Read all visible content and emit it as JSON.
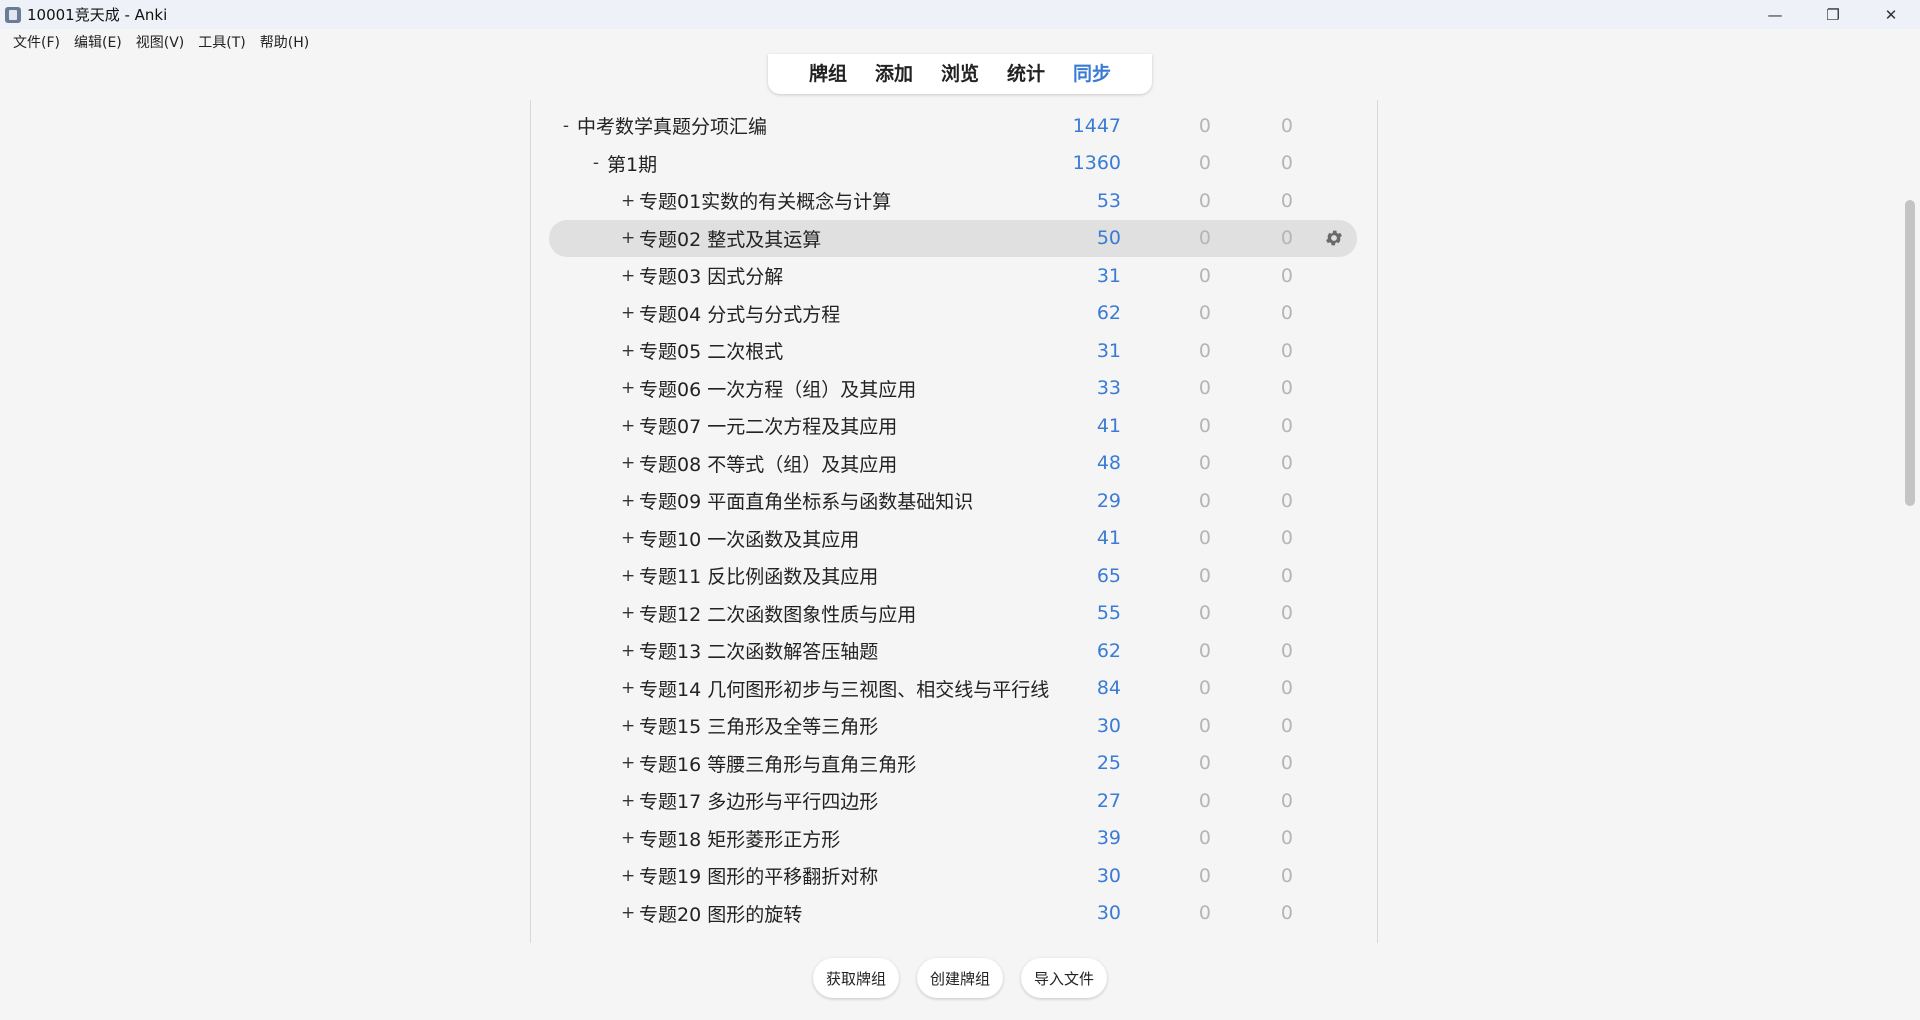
{
  "window": {
    "title": "10001竞天成 - Anki",
    "minimize_glyph": "—",
    "restore_glyph": "❐",
    "close_glyph": "✕"
  },
  "menu": [
    "文件(F)",
    "编辑(E)",
    "视图(V)",
    "工具(T)",
    "帮助(H)"
  ],
  "toolbar": {
    "items": [
      "牌组",
      "添加",
      "浏览",
      "统计",
      "同步"
    ],
    "active_index": 4,
    "active_color": "#3a7bd5"
  },
  "decks": [
    {
      "toggle": "-",
      "name": "中考数学真题分项汇编",
      "level": 0,
      "new": "1447",
      "learn": "0",
      "review": "0"
    },
    {
      "toggle": "-",
      "name": "第1期",
      "level": 1,
      "new": "1360",
      "learn": "0",
      "review": "0"
    },
    {
      "toggle": "+",
      "name": "专题01实数的有关概念与计算",
      "level": 2,
      "new": "53",
      "learn": "0",
      "review": "0"
    },
    {
      "toggle": "+",
      "name": "专题02 整式及其运算",
      "level": 2,
      "new": "50",
      "learn": "0",
      "review": "0",
      "current": true
    },
    {
      "toggle": "+",
      "name": "专题03 因式分解",
      "level": 2,
      "new": "31",
      "learn": "0",
      "review": "0"
    },
    {
      "toggle": "+",
      "name": "专题04 分式与分式方程",
      "level": 2,
      "new": "62",
      "learn": "0",
      "review": "0"
    },
    {
      "toggle": "+",
      "name": "专题05 二次根式",
      "level": 2,
      "new": "31",
      "learn": "0",
      "review": "0"
    },
    {
      "toggle": "+",
      "name": "专题06 一次方程（组）及其应用",
      "level": 2,
      "new": "33",
      "learn": "0",
      "review": "0"
    },
    {
      "toggle": "+",
      "name": "专题07 一元二次方程及其应用",
      "level": 2,
      "new": "41",
      "learn": "0",
      "review": "0"
    },
    {
      "toggle": "+",
      "name": "专题08 不等式（组）及其应用",
      "level": 2,
      "new": "48",
      "learn": "0",
      "review": "0"
    },
    {
      "toggle": "+",
      "name": "专题09 平面直角坐标系与函数基础知识",
      "level": 2,
      "new": "29",
      "learn": "0",
      "review": "0"
    },
    {
      "toggle": "+",
      "name": "专题10 一次函数及其应用",
      "level": 2,
      "new": "41",
      "learn": "0",
      "review": "0"
    },
    {
      "toggle": "+",
      "name": "专题11 反比例函数及其应用",
      "level": 2,
      "new": "65",
      "learn": "0",
      "review": "0"
    },
    {
      "toggle": "+",
      "name": "专题12 二次函数图象性质与应用",
      "level": 2,
      "new": "55",
      "learn": "0",
      "review": "0"
    },
    {
      "toggle": "+",
      "name": "专题13 二次函数解答压轴题",
      "level": 2,
      "new": "62",
      "learn": "0",
      "review": "0"
    },
    {
      "toggle": "+",
      "name": "专题14 几何图形初步与三视图、相交线与平行线",
      "level": 2,
      "new": "84",
      "learn": "0",
      "review": "0"
    },
    {
      "toggle": "+",
      "name": "专题15 三角形及全等三角形",
      "level": 2,
      "new": "30",
      "learn": "0",
      "review": "0"
    },
    {
      "toggle": "+",
      "name": "专题16 等腰三角形与直角三角形",
      "level": 2,
      "new": "25",
      "learn": "0",
      "review": "0"
    },
    {
      "toggle": "+",
      "name": "专题17 多边形与平行四边形",
      "level": 2,
      "new": "27",
      "learn": "0",
      "review": "0"
    },
    {
      "toggle": "+",
      "name": "专题18 矩形菱形正方形",
      "level": 2,
      "new": "39",
      "learn": "0",
      "review": "0"
    },
    {
      "toggle": "+",
      "name": "专题19 图形的平移翻折对称",
      "level": 2,
      "new": "30",
      "learn": "0",
      "review": "0"
    },
    {
      "toggle": "+",
      "name": "专题20 图形的旋转",
      "level": 2,
      "new": "30",
      "learn": "0",
      "review": "0"
    }
  ],
  "colors": {
    "new_count": "#3a7bd5",
    "zero_count": "#b5b5b5",
    "current_row": "#e0e0e0"
  },
  "bottom_buttons": [
    "获取牌组",
    "创建牌组",
    "导入文件"
  ]
}
